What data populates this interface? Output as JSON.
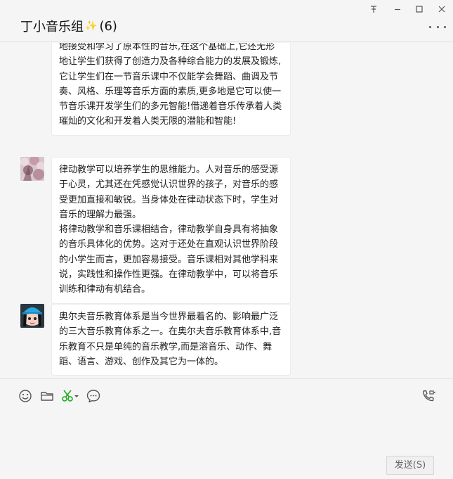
{
  "header": {
    "title": "丁小音乐组",
    "sparkle": "✨",
    "member_count": "(6)"
  },
  "window_controls": [
    "pin-icon",
    "minimize-icon",
    "maximize-icon",
    "close-icon"
  ],
  "messages": [
    {
      "text": "地接受和学习了原本性的音乐,在这个基础上,它还无形地让学生们获得了创造力及各种综合能力的发展及锻炼,它让学生们在一节音乐课中不仅能学会舞蹈、曲调及节奏、风格、乐理等音乐方面的素质,更多地是它可以使一节音乐课开发学生们的多元智能!借递着音乐传承着人类璀灿的文化和开发着人类无限的潜能和智能!"
    },
    {
      "avatar": "avatar-pink-blossoms",
      "text": "律动教学可以培养学生的思维能力。人对音乐的感受源于心灵，尤其还在凭感觉认识世界的孩子，对音乐的感受更加直接和敏锐。当身体处在律动状态下时，学生对音乐的理解力最强。\n将律动教学和音乐课相结合，律动教学自身具有将抽象的音乐具体化的优势。这对于还处在直观认识世界阶段的小学生而言，更加容易接受。音乐课相对其他学科来说，实践性和操作性更强。在律动教学中，可以将音乐训练和律动有机结合。"
    },
    {
      "avatar": "avatar-cartoon-girl-blue-cap",
      "text": "奥尔夫音乐教育体系是当今世界最着名的、影响最广泛的三大音乐教育体系之一。在奥尔夫音乐教育体系中,音乐教育不只是单纯的音乐教学,而是溶音乐、动作、舞蹈、语言、游戏、创作及其它为一体的。"
    }
  ],
  "toolbar": {
    "icons": [
      "emoji-icon",
      "folder-icon",
      "scissors-icon",
      "chat-history-icon",
      "video-call-icon"
    ],
    "accent_color": "#1aad19"
  },
  "composer": {
    "send_label": "发送(S)"
  }
}
